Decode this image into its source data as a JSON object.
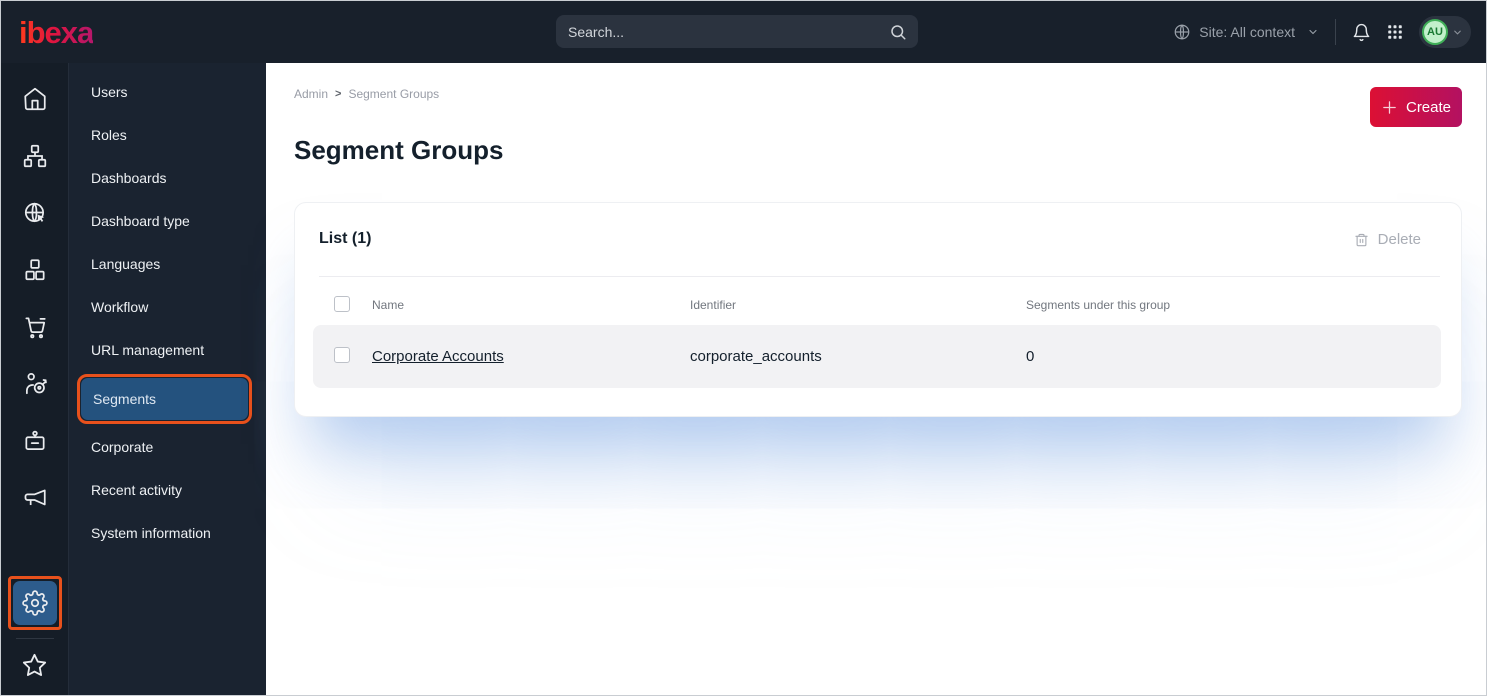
{
  "topbar": {
    "logo_text": "ibexa",
    "search": {
      "placeholder": "Search..."
    },
    "site_context": {
      "label": "Site: All context"
    },
    "avatar": {
      "initials": "AU"
    }
  },
  "icon_rail": {
    "icons": [
      "home-icon",
      "sitemap-icon",
      "site-globe-icon",
      "products-boxes-icon",
      "shopping-cart-icon",
      "personalization-target-icon",
      "customer-badge-icon",
      "marketing-megaphone-icon",
      "settings-gear-icon",
      "favorites-star-icon"
    ],
    "active_icon": "settings-gear-icon"
  },
  "side_menu": {
    "items": [
      {
        "label": "Users"
      },
      {
        "label": "Roles"
      },
      {
        "label": "Dashboards"
      },
      {
        "label": "Dashboard type"
      },
      {
        "label": "Languages"
      },
      {
        "label": "Workflow"
      },
      {
        "label": "URL management"
      },
      {
        "label": "Segments",
        "selected": true,
        "annotated": true
      },
      {
        "label": "Corporate"
      },
      {
        "label": "Recent activity"
      },
      {
        "label": "System information"
      }
    ]
  },
  "breadcrumb": {
    "items": [
      "Admin",
      "Segment Groups"
    ],
    "separator": ">"
  },
  "page": {
    "title": "Segment Groups"
  },
  "actions": {
    "create_label": "Create"
  },
  "list_card": {
    "title": "List (1)",
    "delete_label": "Delete",
    "columns": [
      "Name",
      "Identifier",
      "Segments under this group"
    ],
    "rows": [
      {
        "name": "Corporate Accounts",
        "identifier": "corporate_accounts",
        "segments_count": "0"
      }
    ]
  },
  "colors": {
    "topbar_bg": "#18202b",
    "rail_bg": "#151d27",
    "menu_bg": "#1a2330",
    "annotation_orange": "#e8511c",
    "selected_blue": "#24527e",
    "active_tile_blue": "#2d5c8c",
    "create_gradient_start": "#dc1034",
    "create_gradient_end": "#b31161",
    "avatar_green_bg": "#c2f0cb",
    "avatar_green_text": "#1a7a33",
    "row_bg": "#f2f2f4"
  }
}
